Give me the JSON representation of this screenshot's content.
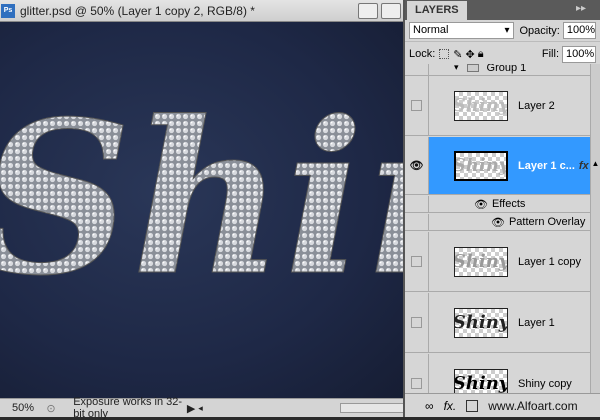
{
  "window": {
    "title": "glitter.psd @ 50% (Layer 1 copy 2, RGB/8) *",
    "app_icon": "Ps"
  },
  "canvas": {
    "text": "Shiny",
    "background": "#1e2846"
  },
  "status": {
    "zoom": "50%",
    "message": "Exposure works in 32-bit only"
  },
  "panel": {
    "tab": "LAYERS",
    "blend_mode": "Normal",
    "opacity_label": "Opacity:",
    "opacity": "100%",
    "lock_label": "Lock:",
    "fill_label": "Fill:",
    "fill": "100%",
    "accent": "#3399ff"
  },
  "layers": [
    {
      "name": "Group 1",
      "type": "group"
    },
    {
      "name": "Layer 2",
      "thumb": "Shiny",
      "visible": false
    },
    {
      "name": "Layer 1 c...",
      "thumb": "Shiny",
      "visible": true,
      "selected": true,
      "fx": "fx"
    },
    {
      "name": "Effects",
      "type": "effect"
    },
    {
      "name": "Pattern Overlay",
      "type": "effect"
    },
    {
      "name": "Layer 1 copy",
      "thumb": "Shiny",
      "visible": false
    },
    {
      "name": "Layer 1",
      "thumb": "Shiny",
      "visible": false
    },
    {
      "name": "Shiny copy",
      "thumb": "Shiny",
      "visible": false
    }
  ],
  "footer": {
    "watermark": "www.Alfoart.com"
  }
}
